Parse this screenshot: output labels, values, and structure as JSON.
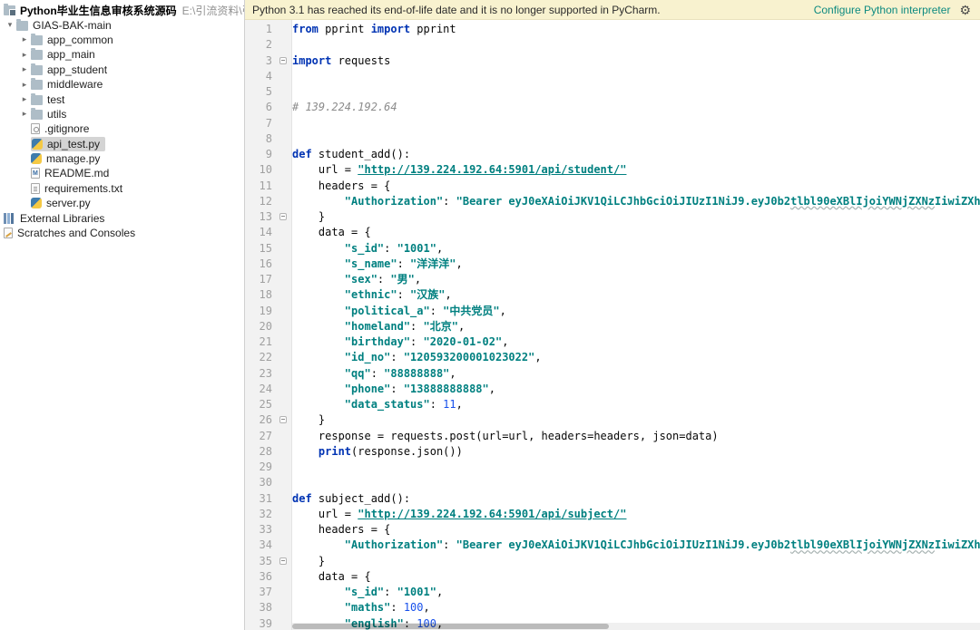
{
  "banner": {
    "message": "Python 3.1 has reached its end-of-life date and it is no longer supported in PyCharm.",
    "action_label": "Configure Python interpreter",
    "bg_color": "#f8f2cf",
    "link_color": "#0d8a80"
  },
  "theme": {
    "keyword_color": "#0033b3",
    "string_color": "#008080",
    "number_color": "#1750eb",
    "comment_color": "#8c8c8c",
    "selection_color": "#d4d4d4"
  },
  "project_tree": {
    "root": {
      "name": "Python毕业生信息审核系统源码",
      "path": "E:\\引流资料\\引流资料科"
    },
    "items": [
      {
        "id": "gias-bak-main",
        "label": "GIAS-BAK-main",
        "icon": "folder",
        "chevron": "down",
        "level": 0,
        "selected": false
      },
      {
        "id": "app-common",
        "label": "app_common",
        "icon": "folder",
        "chevron": "right",
        "level": 1,
        "selected": false
      },
      {
        "id": "app-main",
        "label": "app_main",
        "icon": "folder",
        "chevron": "right",
        "level": 1,
        "selected": false
      },
      {
        "id": "app-student",
        "label": "app_student",
        "icon": "folder",
        "chevron": "right",
        "level": 1,
        "selected": false
      },
      {
        "id": "middleware",
        "label": "middleware",
        "icon": "folder",
        "chevron": "right",
        "level": 1,
        "selected": false
      },
      {
        "id": "test",
        "label": "test",
        "icon": "folder",
        "chevron": "right",
        "level": 1,
        "selected": false
      },
      {
        "id": "utils",
        "label": "utils",
        "icon": "folder",
        "chevron": "right",
        "level": 1,
        "selected": false
      },
      {
        "id": "gitignore",
        "label": ".gitignore",
        "icon": "gitfile",
        "chevron": "spacer",
        "level": 1,
        "selected": false
      },
      {
        "id": "api-test-py",
        "label": "api_test.py",
        "icon": "python",
        "chevron": "spacer",
        "level": 1,
        "selected": true
      },
      {
        "id": "manage-py",
        "label": "manage.py",
        "icon": "python",
        "chevron": "spacer",
        "level": 1,
        "selected": false
      },
      {
        "id": "readme-md",
        "label": "README.md",
        "icon": "markdown",
        "chevron": "spacer",
        "level": 1,
        "selected": false
      },
      {
        "id": "requirements-txt",
        "label": "requirements.txt",
        "icon": "textfile",
        "chevron": "spacer",
        "level": 1,
        "selected": false
      },
      {
        "id": "server-py",
        "label": "server.py",
        "icon": "python",
        "chevron": "spacer",
        "level": 1,
        "selected": false
      },
      {
        "id": "external-libraries",
        "label": "External Libraries",
        "icon": "libraries",
        "chevron": "none",
        "level": 0,
        "selected": false
      },
      {
        "id": "scratches-and-consoles",
        "label": "Scratches and Consoles",
        "icon": "scratches",
        "chevron": "none",
        "level": 0,
        "selected": false
      }
    ]
  },
  "editor": {
    "lines": [
      {
        "n": 1,
        "f": "",
        "t": [
          [
            "k",
            "from"
          ],
          [
            "p",
            " pprint "
          ],
          [
            "k",
            "import"
          ],
          [
            "p",
            " pprint"
          ]
        ]
      },
      {
        "n": 2,
        "f": "",
        "t": []
      },
      {
        "n": 3,
        "f": "box",
        "t": [
          [
            "k",
            "import"
          ],
          [
            "p",
            " requests"
          ]
        ]
      },
      {
        "n": 4,
        "f": "",
        "t": []
      },
      {
        "n": 5,
        "f": "",
        "t": []
      },
      {
        "n": 6,
        "f": "",
        "t": [
          [
            "c",
            "# 139.224.192.64"
          ]
        ]
      },
      {
        "n": 7,
        "f": "",
        "t": []
      },
      {
        "n": 8,
        "f": "",
        "t": []
      },
      {
        "n": 9,
        "f": "",
        "t": [
          [
            "k",
            "def"
          ],
          [
            "p",
            " student_add():"
          ]
        ]
      },
      {
        "n": 10,
        "f": "",
        "t": [
          [
            "p",
            "    url = "
          ],
          [
            "u",
            "\"http://139.224.192.64:5901/api/student/\""
          ]
        ]
      },
      {
        "n": 11,
        "f": "",
        "t": [
          [
            "p",
            "    headers = {"
          ]
        ]
      },
      {
        "n": 12,
        "f": "",
        "t": [
          [
            "p",
            "        "
          ],
          [
            "s",
            "\"Authorization\""
          ],
          [
            "p",
            ": "
          ],
          [
            "s",
            "\"Bearer eyJ0eXAiOiJKV1QiLCJhbGciOiJIUzI1NiJ9.eyJ0b2"
          ],
          [
            "w",
            "tlbl90eXBlIjoiYWNjZXNz"
          ],
          [
            "s",
            "IiwiZXhwIjoxNjUyN"
          ]
        ]
      },
      {
        "n": 13,
        "f": "box",
        "t": [
          [
            "p",
            "    }"
          ]
        ]
      },
      {
        "n": 14,
        "f": "",
        "t": [
          [
            "p",
            "    data = {"
          ]
        ]
      },
      {
        "n": 15,
        "f": "",
        "t": [
          [
            "p",
            "        "
          ],
          [
            "s",
            "\"s_id\""
          ],
          [
            "p",
            ": "
          ],
          [
            "s",
            "\"1001\""
          ],
          [
            "p",
            ","
          ]
        ]
      },
      {
        "n": 16,
        "f": "",
        "t": [
          [
            "p",
            "        "
          ],
          [
            "s",
            "\"s_name\""
          ],
          [
            "p",
            ": "
          ],
          [
            "s",
            "\"洋洋洋\""
          ],
          [
            "p",
            ","
          ]
        ]
      },
      {
        "n": 17,
        "f": "",
        "t": [
          [
            "p",
            "        "
          ],
          [
            "s",
            "\"sex\""
          ],
          [
            "p",
            ": "
          ],
          [
            "s",
            "\"男\""
          ],
          [
            "p",
            ","
          ]
        ]
      },
      {
        "n": 18,
        "f": "",
        "t": [
          [
            "p",
            "        "
          ],
          [
            "s",
            "\"ethnic\""
          ],
          [
            "p",
            ": "
          ],
          [
            "s",
            "\"汉族\""
          ],
          [
            "p",
            ","
          ]
        ]
      },
      {
        "n": 19,
        "f": "",
        "t": [
          [
            "p",
            "        "
          ],
          [
            "s",
            "\"political_a\""
          ],
          [
            "p",
            ": "
          ],
          [
            "s",
            "\"中共党员\""
          ],
          [
            "p",
            ","
          ]
        ]
      },
      {
        "n": 20,
        "f": "",
        "t": [
          [
            "p",
            "        "
          ],
          [
            "s",
            "\"homeland\""
          ],
          [
            "p",
            ": "
          ],
          [
            "s",
            "\"北京\""
          ],
          [
            "p",
            ","
          ]
        ]
      },
      {
        "n": 21,
        "f": "",
        "t": [
          [
            "p",
            "        "
          ],
          [
            "s",
            "\"birthday\""
          ],
          [
            "p",
            ": "
          ],
          [
            "s",
            "\"2020-01-02\""
          ],
          [
            "p",
            ","
          ]
        ]
      },
      {
        "n": 22,
        "f": "",
        "t": [
          [
            "p",
            "        "
          ],
          [
            "s",
            "\"id_no\""
          ],
          [
            "p",
            ": "
          ],
          [
            "s",
            "\"120593200001023022\""
          ],
          [
            "p",
            ","
          ]
        ]
      },
      {
        "n": 23,
        "f": "",
        "t": [
          [
            "p",
            "        "
          ],
          [
            "s",
            "\"qq\""
          ],
          [
            "p",
            ": "
          ],
          [
            "s",
            "\"88888888\""
          ],
          [
            "p",
            ","
          ]
        ]
      },
      {
        "n": 24,
        "f": "",
        "t": [
          [
            "p",
            "        "
          ],
          [
            "s",
            "\"phone\""
          ],
          [
            "p",
            ": "
          ],
          [
            "s",
            "\"13888888888\""
          ],
          [
            "p",
            ","
          ]
        ]
      },
      {
        "n": 25,
        "f": "",
        "t": [
          [
            "p",
            "        "
          ],
          [
            "s",
            "\"data_status\""
          ],
          [
            "p",
            ": "
          ],
          [
            "n",
            "11"
          ],
          [
            "p",
            ","
          ]
        ]
      },
      {
        "n": 26,
        "f": "box",
        "t": [
          [
            "p",
            "    }"
          ]
        ]
      },
      {
        "n": 27,
        "f": "",
        "t": [
          [
            "p",
            "    response = requests.post(url=url, headers=headers, json=data)"
          ]
        ]
      },
      {
        "n": 28,
        "f": "",
        "t": [
          [
            "p",
            "    "
          ],
          [
            "k",
            "print"
          ],
          [
            "p",
            "(response.json())"
          ]
        ]
      },
      {
        "n": 29,
        "f": "",
        "t": []
      },
      {
        "n": 30,
        "f": "",
        "t": []
      },
      {
        "n": 31,
        "f": "",
        "t": [
          [
            "k",
            "def"
          ],
          [
            "p",
            " subject_add():"
          ]
        ]
      },
      {
        "n": 32,
        "f": "",
        "t": [
          [
            "p",
            "    url = "
          ],
          [
            "u",
            "\"http://139.224.192.64:5901/api/subject/\""
          ]
        ]
      },
      {
        "n": 33,
        "f": "",
        "t": [
          [
            "p",
            "    headers = {"
          ]
        ]
      },
      {
        "n": 34,
        "f": "",
        "t": [
          [
            "p",
            "        "
          ],
          [
            "s",
            "\"Authorization\""
          ],
          [
            "p",
            ": "
          ],
          [
            "s",
            "\"Bearer eyJ0eXAiOiJKV1QiLCJhbGciOiJIUzI1NiJ9.eyJ0b2"
          ],
          [
            "w",
            "tlbl90eXBlIjoiYWNjZXNz"
          ],
          [
            "s",
            "IiwiZXhwIjoxNjUyN"
          ]
        ]
      },
      {
        "n": 35,
        "f": "box",
        "t": [
          [
            "p",
            "    }"
          ]
        ]
      },
      {
        "n": 36,
        "f": "",
        "t": [
          [
            "p",
            "    data = {"
          ]
        ]
      },
      {
        "n": 37,
        "f": "",
        "t": [
          [
            "p",
            "        "
          ],
          [
            "s",
            "\"s_id\""
          ],
          [
            "p",
            ": "
          ],
          [
            "s",
            "\"1001\""
          ],
          [
            "p",
            ","
          ]
        ]
      },
      {
        "n": 38,
        "f": "",
        "t": [
          [
            "p",
            "        "
          ],
          [
            "s",
            "\"maths\""
          ],
          [
            "p",
            ": "
          ],
          [
            "n",
            "100"
          ],
          [
            "p",
            ","
          ]
        ]
      },
      {
        "n": 39,
        "f": "",
        "t": [
          [
            "p",
            "        "
          ],
          [
            "s",
            "\"english\""
          ],
          [
            "p",
            ": "
          ],
          [
            "n",
            "100"
          ],
          [
            "p",
            ","
          ]
        ]
      }
    ]
  }
}
